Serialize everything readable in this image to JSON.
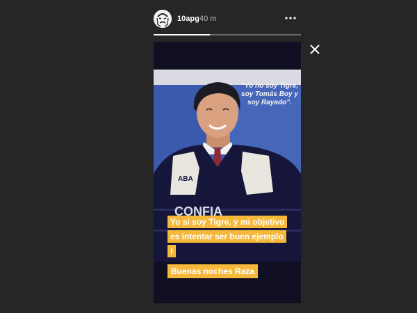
{
  "header": {
    "username": "10apg",
    "timestamp": "40 m",
    "avatar_icon": "avatar-face-icon",
    "more_icon": "more-horizontal-icon"
  },
  "progress": {
    "fraction": 0.38,
    "fill_color": "#ffffff",
    "track_color": "#6d6d6d"
  },
  "close_icon": "close-icon",
  "story": {
    "banner_quote": "“Yo no soy Tigre, soy Tomás Boy y soy Rayado”.",
    "jersey_text_1": "ABA",
    "jersey_text_2": "CONFIA",
    "caption": "Yo si soy Tigre, y mi objetivo es intentar ser buen ejemplo !",
    "caption_2": "Buenas noches Raza",
    "highlight_color": "#f5b83b"
  }
}
